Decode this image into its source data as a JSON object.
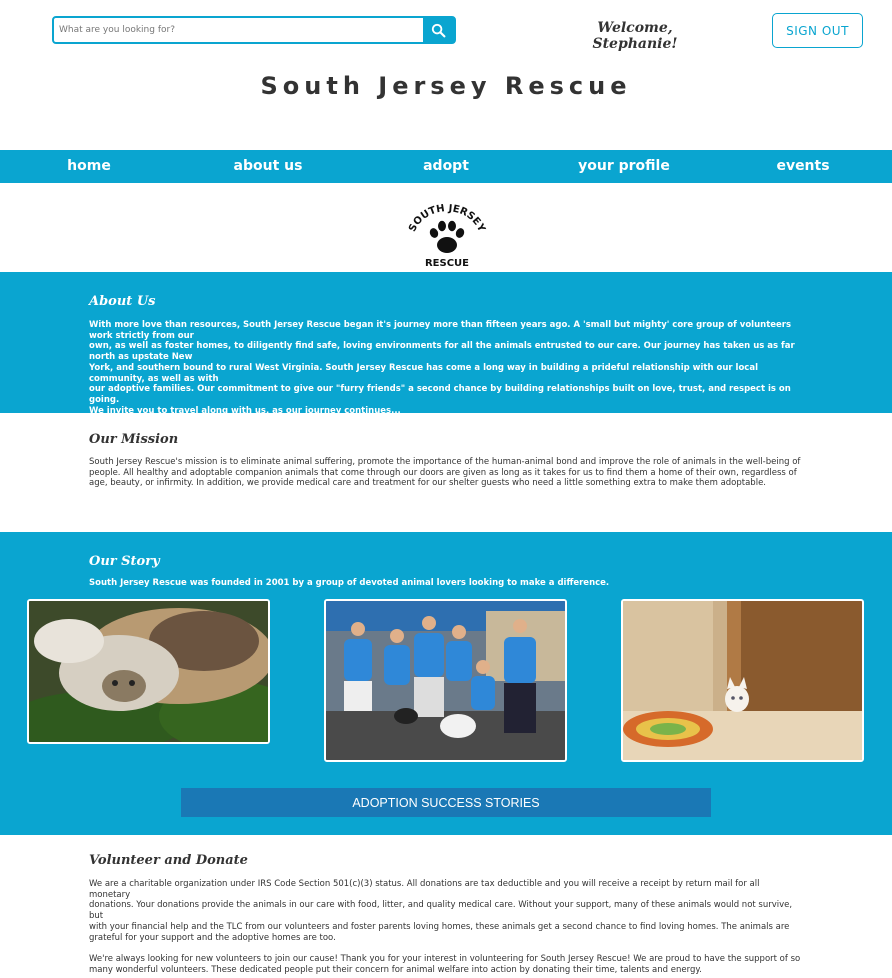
{
  "search": {
    "placeholder": "What are you looking for?",
    "icon": "search-icon"
  },
  "user": {
    "welcome": "Welcome, Stephanie!",
    "signout_label": "SIGN OUT"
  },
  "site": {
    "title": "South Jersey Rescue"
  },
  "nav": {
    "items": [
      {
        "label": "home"
      },
      {
        "label": "about us"
      },
      {
        "label": "adopt"
      },
      {
        "label": "your profile"
      },
      {
        "label": "events"
      }
    ]
  },
  "logo": {
    "top_text": "SOUTH JERSEY",
    "bottom_text": "RESCUE"
  },
  "about": {
    "heading": "About Us",
    "lines": [
      "With more love than resources, South Jersey Rescue began it's journey more than fifteen years ago. A 'small but mighty' core group of volunteers work strictly from our",
      "own, as well as foster homes, to diligently find safe, loving environments for all the animals entrusted to our care. Our journey has taken us as far north as upstate New",
      "York, and southern bound to rural West Virginia. South Jersey Rescue has come a long way in building a prideful relationship with our local community, as well as with",
      "our adoptive families. Our commitment to give our \"furry friends\" a second chance by building relationships built on love, trust, and respect is on going.",
      "We invite you to travel along with us, as our journey continues..."
    ]
  },
  "mission": {
    "heading": "Our Mission",
    "lines": [
      "South Jersey Rescue's mission is to eliminate animal suffering, promote the importance of the human-animal bond and improve the role of animals in the well-being of",
      "people. All healthy and adoptable companion animals that come through our doors are given as long as it takes for us to find them a home of their own, regardless of",
      "age, beauty, or infirmity. In addition, we provide medical care and treatment for our shelter guests who need a little something extra to make them adoptable."
    ]
  },
  "story": {
    "heading": "Our Story",
    "text": "South Jersey Rescue was founded in 2001 by a group of devoted animal lovers looking to make a difference."
  },
  "buttons": {
    "adoption_stories": "ADOPTION SUCCESS STORIES"
  },
  "volunteer": {
    "heading": "Volunteer and Donate",
    "para1_lines": [
      "We are a charitable organization under IRS Code Section 501(c)(3) status. All donations are tax deductible and you will receive a receipt by return mail for all monetary",
      "donations. Your donations provide the animals in our care with food, litter, and quality medical care. Without your support, many of these animals would not survive, but",
      "with your financial help and the TLC from our volunteers and foster parents loving homes, these animals get a second chance to find loving homes. The animals are",
      "grateful for your support and the adoptive homes are too."
    ],
    "para2_lines": [
      "We're always looking for new volunteers to join our cause! Thank you for your interest in volunteering for South Jersey Rescue! We are proud to have the support of so",
      "many wonderful volunteers. These dedicated people put their concern for animal welfare into action by donating their time, talents and energy."
    ]
  },
  "colors": {
    "accent": "#0aa5d0",
    "button": "#1a78b5",
    "text": "#333333"
  }
}
